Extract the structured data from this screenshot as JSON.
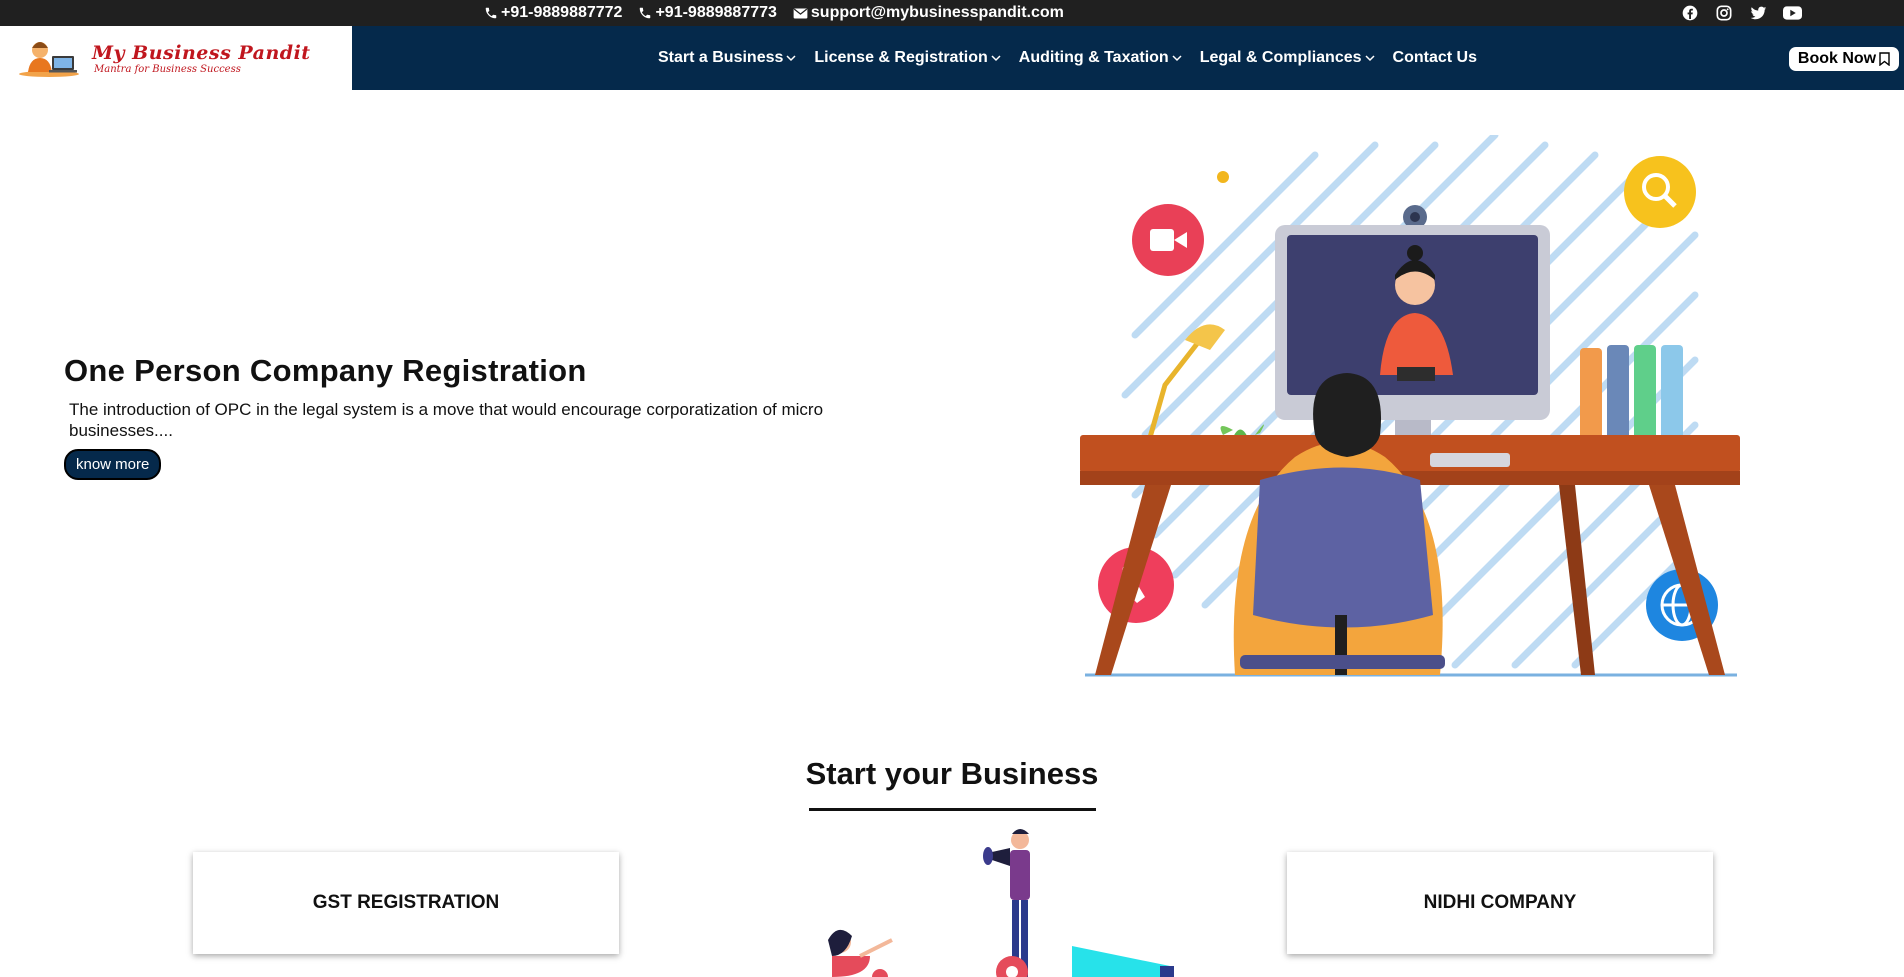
{
  "topbar": {
    "phone1": "+91-9889887772",
    "phone2": "+91-9889887773",
    "email": "support@mybusinesspandit.com",
    "social_icons": [
      "facebook-icon",
      "instagram-icon",
      "twitter-icon",
      "youtube-icon"
    ]
  },
  "logo": {
    "name": "My Business Pandit",
    "tagline": "Mantra for Business Success"
  },
  "nav": {
    "items": [
      {
        "label": "Start a Business",
        "has_dropdown": true
      },
      {
        "label": "License & Registration",
        "has_dropdown": true
      },
      {
        "label": "Auditing & Taxation",
        "has_dropdown": true
      },
      {
        "label": "Legal & Compliances",
        "has_dropdown": true
      },
      {
        "label": "Contact Us",
        "has_dropdown": false
      }
    ],
    "book_label": "Book Now"
  },
  "hero": {
    "title": "One Person Company Registration",
    "description": "The introduction of OPC in the legal system is a move that would encourage corporatization of micro businesses....",
    "button": "know more"
  },
  "section": {
    "title": "Start your Business",
    "cards": [
      "GST REGISTRATION",
      "NIDHI COMPANY"
    ]
  },
  "colors": {
    "navbar": "#05294b",
    "topbar": "#202020",
    "brand_red": "#c0161e"
  }
}
